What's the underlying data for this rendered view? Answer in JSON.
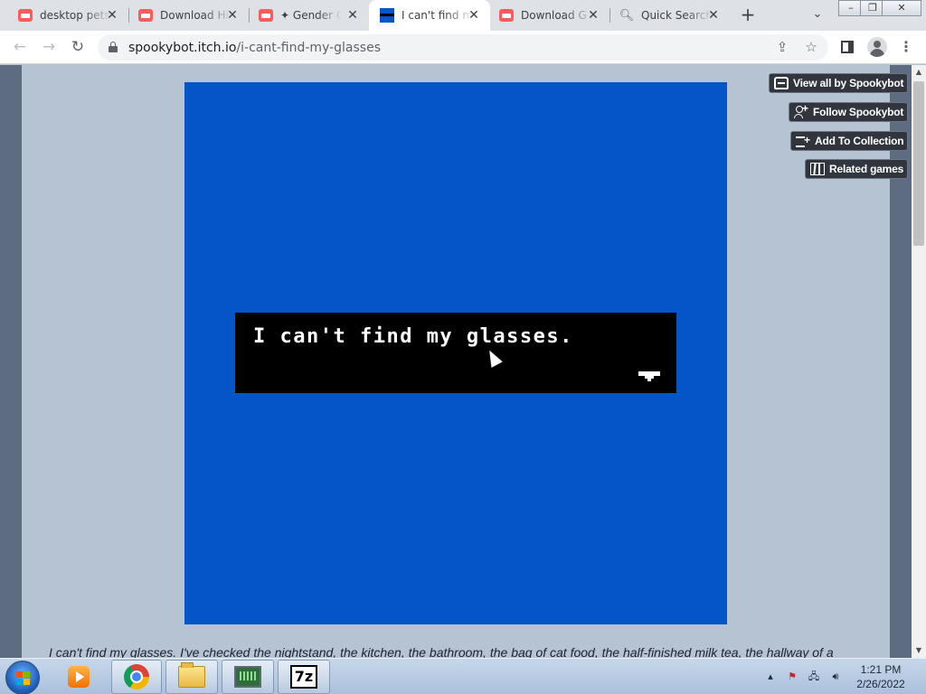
{
  "browser": {
    "tabs": [
      {
        "title": "desktop pets",
        "favicon": "itch-icon",
        "active": false
      },
      {
        "title": "Download Hi",
        "favicon": "itch-icon",
        "active": false
      },
      {
        "title": "Gender Cl",
        "favicon": "itch-icon",
        "active": false
      },
      {
        "title": "I can't find my",
        "favicon": "blue-square-icon",
        "active": true
      },
      {
        "title": "Download G",
        "favicon": "itch-icon",
        "active": false
      },
      {
        "title": "Quick Search",
        "favicon": "search-icon",
        "active": false
      }
    ],
    "new_tab": "+",
    "address": {
      "domain": "spookybot.itch.io",
      "path": "/i-cant-find-my-glasses"
    }
  },
  "page": {
    "game": {
      "dialog_text": "I can't find my glasses.",
      "background": "#0455c8"
    },
    "buttons": {
      "view_all": "View all by Spookybot",
      "follow": "Follow Spookybot",
      "add_collection": "Add To Collection",
      "related": "Related games"
    },
    "description": "I can't find my glasses. I've checked the nightstand, the kitchen, the bathroom, the bag of cat food, the half-finished milk tea, the hallway of a"
  },
  "taskbar": {
    "apps": [
      "media-player-icon",
      "chrome-icon",
      "file-explorer-icon",
      "monitor-app-icon",
      "7zip-icon"
    ],
    "clock": {
      "time": "1:21 PM",
      "date": "2/26/2022"
    }
  },
  "colors": {
    "page_bg": "#b6c3d3",
    "side_dark": "#5c6b7f",
    "game_blue": "#0455c8",
    "button_bg": "#31363e"
  }
}
